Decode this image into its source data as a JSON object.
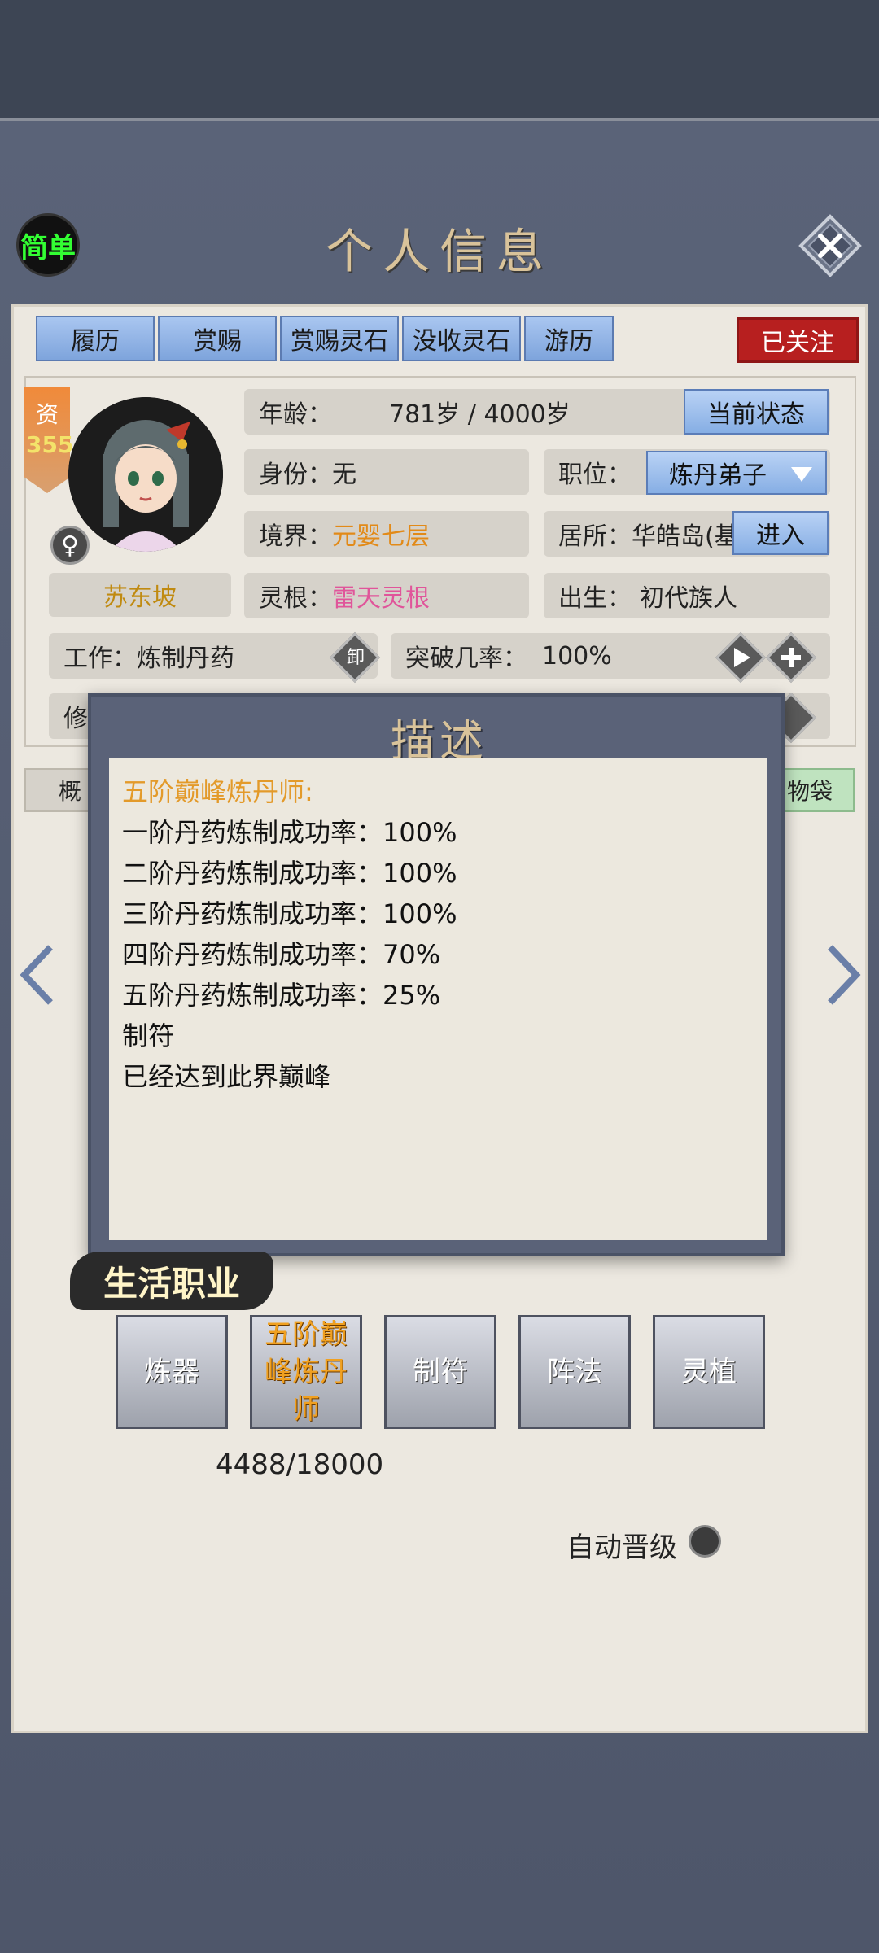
{
  "header": {
    "simple_label": "简单",
    "title": "个人信息"
  },
  "tabs": [
    {
      "label": "履历"
    },
    {
      "label": "赏赐"
    },
    {
      "label": "赏赐灵石"
    },
    {
      "label": "没收灵石"
    },
    {
      "label": "游历"
    }
  ],
  "followed_label": "已关注",
  "profile": {
    "aptitude_label": "资",
    "aptitude_value": "355",
    "gender_symbol": "♀",
    "name": "苏东坡",
    "age_label": "年龄：",
    "age_value": "781岁 / 4000岁",
    "status_button": "当前状态",
    "identity_label": "身份：",
    "identity_value": "无",
    "position_label": "职位：",
    "position_value": "炼丹弟子",
    "realm_label": "境界：",
    "realm_value": "元婴七层",
    "residence_label": "居所：",
    "residence_value": "华皓岛(基",
    "enter_button": "进入",
    "root_label": "灵根：",
    "root_value": "雷天灵根",
    "birth_label": "出生：",
    "birth_value": "初代族人",
    "work_label": "工作：",
    "work_value": "炼制丹药",
    "unload_label": "卸",
    "breakthrough_label": "突破几率：",
    "breakthrough_value": "100%",
    "cultivation_partial": "修"
  },
  "sub_tabs": {
    "left_partial": "概",
    "right_partial": "物袋"
  },
  "description": {
    "title": "描述",
    "heading": "五阶巅峰炼丹师:",
    "lines": [
      "一阶丹药炼制成功率：100%",
      "二阶丹药炼制成功率：100%",
      "三阶丹药炼制成功率：100%",
      "四阶丹药炼制成功率：70%",
      "五阶丹药炼制成功率：25%",
      "制符",
      "已经达到此界巅峰"
    ]
  },
  "life_jobs": {
    "title": "生活职业",
    "buttons": [
      "炼器",
      "五阶巅峰炼丹师",
      "制符",
      "阵法",
      "灵植"
    ],
    "progress": "4488/18000",
    "auto_promote_label": "自动晋级"
  }
}
